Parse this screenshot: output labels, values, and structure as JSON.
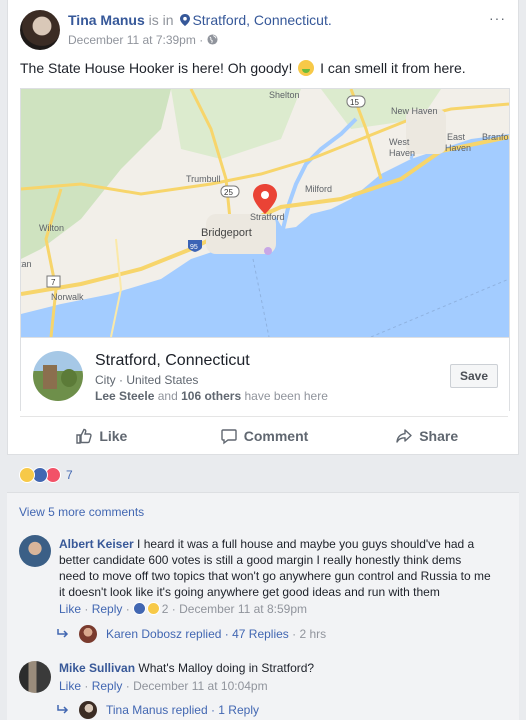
{
  "post": {
    "author": "Tina Manus",
    "is_in": "is in",
    "place": "Stratford, Connecticut.",
    "timestamp": "December 11 at 7:39pm",
    "text_before": "The State House Hooker is here! Oh goody!",
    "text_after": "I can smell it from here.",
    "more": "···"
  },
  "map": {
    "labels": {
      "shelton": "Shelton",
      "new_haven": "New Haven",
      "west_haven": "West",
      "west_haven2": "Haven",
      "east_haven": "East",
      "east_haven2": "Haven",
      "branford": "Branfo",
      "trumbull": "Trumbull",
      "milford": "Milford",
      "stratford": "Stratford",
      "wilton": "Wilton",
      "bridgeport": "Bridgeport",
      "stamford_partial": "tan",
      "norwalk": "Norwalk",
      "route25": "25",
      "route15": "15",
      "route95": "95",
      "route7": "7"
    }
  },
  "place_card": {
    "name": "Stratford, Connecticut",
    "category": "City",
    "country": "United States",
    "friend": "Lee Steele",
    "friends_and": "and",
    "others": "106 others",
    "been_here": "have been here",
    "save_label": "Save"
  },
  "actions": {
    "like": "Like",
    "comment": "Comment",
    "share": "Share"
  },
  "reactions": {
    "count": "7"
  },
  "comments": {
    "view_more": "View 5 more comments",
    "items": [
      {
        "author": "Albert Keiser",
        "text": "I heard it was a full house and maybe you guys should've had a better candidate 600 votes is still a good margin I really honestly think dems need to move off two topics that won't go anywhere gun control and Russia to me it doesn't look like it's going anywhere get good ideas and run with them",
        "like": "Like",
        "reply": "Reply",
        "reaction_count": "2",
        "time": "December 11 at 8:59pm",
        "replies_author": "Karen Dobosz",
        "replied": "replied",
        "replies_count": "47 Replies",
        "replies_time": "2 hrs"
      },
      {
        "author": "Mike Sullivan",
        "text": "What's Malloy doing in Stratford?",
        "like": "Like",
        "reply": "Reply",
        "time": "December 11 at 10:04pm",
        "replies_author": "Tina Manus",
        "replied": "replied",
        "replies_count": "1 Reply"
      }
    ]
  },
  "colors": {
    "fb_blue": "#4267b2",
    "link_blue": "#365899",
    "water": "#a3ccff",
    "land": "#f2efe9",
    "pin": "#ea4335"
  }
}
